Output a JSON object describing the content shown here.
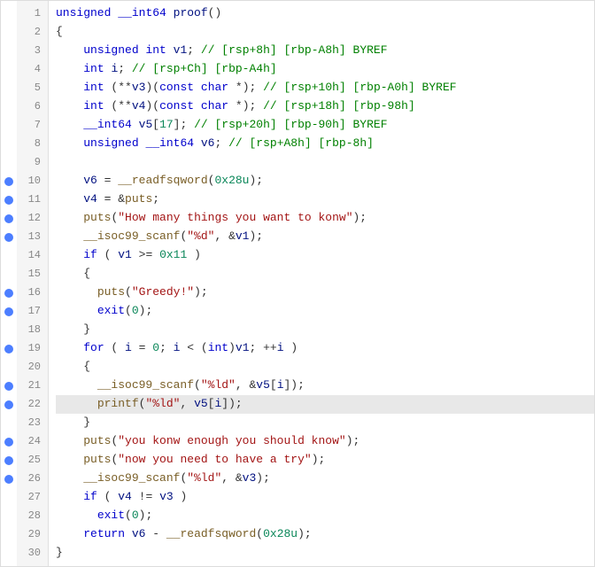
{
  "lines": [
    {
      "num": 1,
      "bp": false,
      "highlight": false,
      "tokens": [
        {
          "t": "unsigned __int64 proof()",
          "c": "plain"
        }
      ]
    },
    {
      "num": 2,
      "bp": false,
      "highlight": false,
      "tokens": [
        {
          "t": "{",
          "c": "punct"
        }
      ]
    },
    {
      "num": 3,
      "bp": false,
      "highlight": false,
      "tokens": [
        {
          "t": "    unsigned int v1; // [rsp+8h] [rbp-A8h] BYREF",
          "c": "comment_line"
        }
      ]
    },
    {
      "num": 4,
      "bp": false,
      "highlight": false,
      "tokens": [
        {
          "t": "    int i; // [rsp+Ch] [rbp-A4h]",
          "c": "comment_line"
        }
      ]
    },
    {
      "num": 5,
      "bp": false,
      "highlight": false,
      "tokens": [
        {
          "t": "    int (**v3)(const char *); // [rsp+10h] [rbp-A0h] BYREF",
          "c": "comment_line"
        }
      ]
    },
    {
      "num": 6,
      "bp": false,
      "highlight": false,
      "tokens": [
        {
          "t": "    int (**v4)(const char *); // [rsp+18h] [rbp-98h]",
          "c": "comment_line"
        }
      ]
    },
    {
      "num": 7,
      "bp": false,
      "highlight": false,
      "tokens": [
        {
          "t": "    __int64 v5[17]; // [rsp+20h] [rbp-90h] BYREF",
          "c": "comment_line"
        }
      ]
    },
    {
      "num": 8,
      "bp": false,
      "highlight": false,
      "tokens": [
        {
          "t": "    unsigned __int64 v6; // [rsp+A8h] [rbp-8h]",
          "c": "comment_line"
        }
      ]
    },
    {
      "num": 9,
      "bp": false,
      "highlight": false,
      "tokens": [
        {
          "t": "",
          "c": "plain"
        }
      ]
    },
    {
      "num": 10,
      "bp": true,
      "highlight": false,
      "tokens": [
        {
          "t": "    v6 = __readfsqword(0x28u);",
          "c": "mixed_10"
        }
      ]
    },
    {
      "num": 11,
      "bp": true,
      "highlight": false,
      "tokens": [
        {
          "t": "    v4 = &puts;",
          "c": "mixed_11"
        }
      ]
    },
    {
      "num": 12,
      "bp": true,
      "highlight": false,
      "tokens": [
        {
          "t": "    puts(\"How many things you want to konw\");",
          "c": "mixed_12"
        }
      ]
    },
    {
      "num": 13,
      "bp": true,
      "highlight": false,
      "tokens": [
        {
          "t": "    __isoc99_scanf(\"%d\", &v1);",
          "c": "mixed_13"
        }
      ]
    },
    {
      "num": 14,
      "bp": false,
      "highlight": false,
      "tokens": [
        {
          "t": "    if ( v1 >= 0x11 )",
          "c": "mixed_14"
        }
      ]
    },
    {
      "num": 15,
      "bp": false,
      "highlight": false,
      "tokens": [
        {
          "t": "    {",
          "c": "punct"
        }
      ]
    },
    {
      "num": 16,
      "bp": true,
      "highlight": false,
      "tokens": [
        {
          "t": "      puts(\"Greedy!\");",
          "c": "mixed_16"
        }
      ]
    },
    {
      "num": 17,
      "bp": true,
      "highlight": false,
      "tokens": [
        {
          "t": "      exit(0);",
          "c": "mixed_17"
        }
      ]
    },
    {
      "num": 18,
      "bp": false,
      "highlight": false,
      "tokens": [
        {
          "t": "    }",
          "c": "punct"
        }
      ]
    },
    {
      "num": 19,
      "bp": true,
      "highlight": false,
      "tokens": [
        {
          "t": "    for ( i = 0; i < (int)v1; ++i )",
          "c": "mixed_19"
        }
      ]
    },
    {
      "num": 20,
      "bp": false,
      "highlight": false,
      "tokens": [
        {
          "t": "    {",
          "c": "punct"
        }
      ]
    },
    {
      "num": 21,
      "bp": true,
      "highlight": false,
      "tokens": [
        {
          "t": "      __isoc99_scanf(\"%ld\", &v5[i]);",
          "c": "mixed_21"
        }
      ]
    },
    {
      "num": 22,
      "bp": true,
      "highlight": true,
      "tokens": [
        {
          "t": "      printf(\"%ld\", v5[i]);",
          "c": "mixed_22"
        }
      ]
    },
    {
      "num": 23,
      "bp": false,
      "highlight": false,
      "tokens": [
        {
          "t": "    }",
          "c": "punct"
        }
      ]
    },
    {
      "num": 24,
      "bp": true,
      "highlight": false,
      "tokens": [
        {
          "t": "    puts(\"you konw enough you should know\");",
          "c": "mixed_24"
        }
      ]
    },
    {
      "num": 25,
      "bp": true,
      "highlight": false,
      "tokens": [
        {
          "t": "    puts(\"now you need to have a try\");",
          "c": "mixed_25"
        }
      ]
    },
    {
      "num": 26,
      "bp": true,
      "highlight": false,
      "tokens": [
        {
          "t": "    __isoc99_scanf(\"%ld\", &v3);",
          "c": "mixed_26"
        }
      ]
    },
    {
      "num": 27,
      "bp": false,
      "highlight": false,
      "tokens": [
        {
          "t": "    if ( v4 != v3 )",
          "c": "mixed_27"
        }
      ]
    },
    {
      "num": 28,
      "bp": false,
      "highlight": false,
      "tokens": [
        {
          "t": "      exit(0);",
          "c": "mixed_17"
        }
      ]
    },
    {
      "num": 29,
      "bp": false,
      "highlight": false,
      "tokens": [
        {
          "t": "    return v6 - __readfsqword(0x28u);",
          "c": "mixed_29"
        }
      ]
    },
    {
      "num": 30,
      "bp": false,
      "highlight": false,
      "tokens": [
        {
          "t": "}",
          "c": "punct"
        }
      ]
    }
  ]
}
